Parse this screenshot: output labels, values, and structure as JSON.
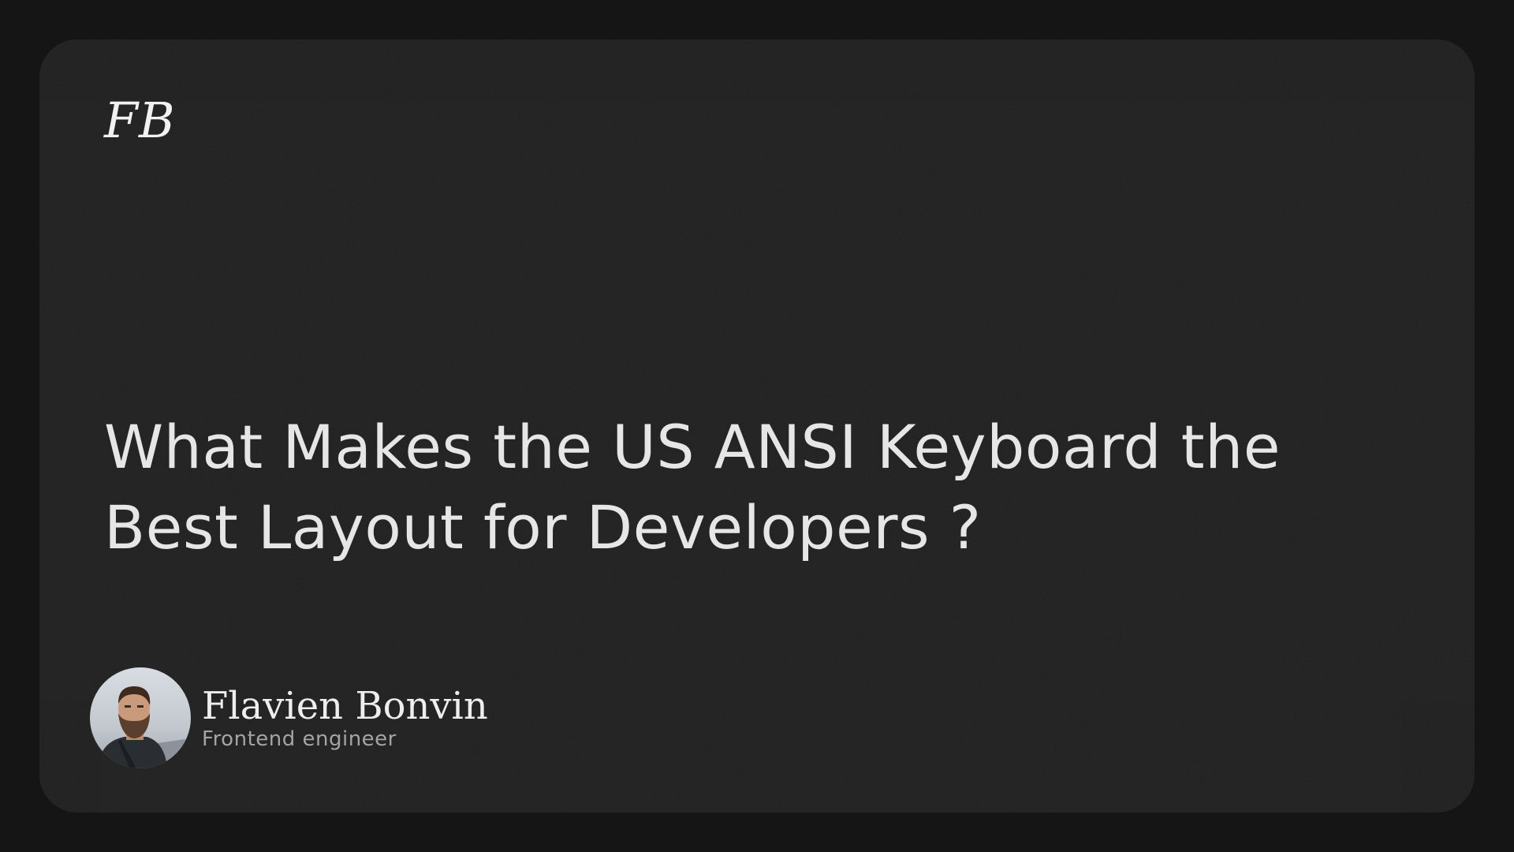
{
  "brand": {
    "logo_text": "FB"
  },
  "article": {
    "title": "What Makes the US ANSI Keyboard the Best Layout for Developers ?"
  },
  "author": {
    "name": "Flavien Bonvin",
    "role": "Frontend engineer",
    "avatar_icon": "person-avatar-icon"
  },
  "colors": {
    "page_background": "#151515",
    "card_background": "#1d1d1d",
    "title_text": "#e6e6e6",
    "subtitle_text": "#a4a4a4"
  }
}
